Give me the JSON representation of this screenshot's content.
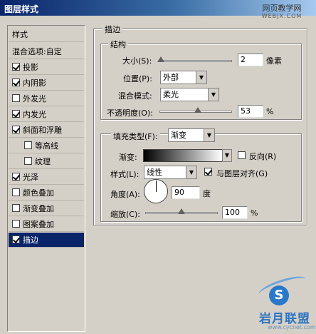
{
  "window": {
    "title": "图层样式"
  },
  "watermark_top": {
    "line1": "网页教学网",
    "line2": "WEBJX.COM"
  },
  "sidebar": {
    "header": "样式",
    "blend_options": "混合选项:自定",
    "items": [
      {
        "label": "投影",
        "checked": true
      },
      {
        "label": "内阴影",
        "checked": true
      },
      {
        "label": "外发光",
        "checked": false
      },
      {
        "label": "内发光",
        "checked": true
      },
      {
        "label": "斜面和浮雕",
        "checked": true
      },
      {
        "label": "等高线",
        "checked": false
      },
      {
        "label": "纹理",
        "checked": false
      },
      {
        "label": "光泽",
        "checked": true
      },
      {
        "label": "颜色叠加",
        "checked": false
      },
      {
        "label": "渐变叠加",
        "checked": false
      },
      {
        "label": "图案叠加",
        "checked": false
      },
      {
        "label": "描边",
        "checked": true,
        "selected": true
      }
    ]
  },
  "stroke": {
    "title": "描边",
    "structure": {
      "title": "结构",
      "size_label": "大小(S):",
      "size_value": "2",
      "size_unit": "像素",
      "size_fraction": 0.02,
      "position_label": "位置(P):",
      "position_value": "外部",
      "blend_mode_label": "混合模式:",
      "blend_mode_value": "柔光",
      "opacity_label": "不透明度(O):",
      "opacity_value": "53",
      "opacity_unit": "%",
      "opacity_fraction": 0.53
    },
    "fill": {
      "fill_type_label": "填充类型(F):",
      "fill_type_value": "渐变",
      "gradient_label": "渐变:",
      "reverse_label": "反向(R)",
      "reverse_checked": false,
      "style_label": "样式(L):",
      "style_value": "线性",
      "align_label": "与图层对齐(G)",
      "align_checked": true,
      "angle_label": "角度(A):",
      "angle_value": "90",
      "angle_unit": "度",
      "scale_label": "缩放(C):",
      "scale_value": "100",
      "scale_unit": "%",
      "scale_fraction": 0.5
    }
  },
  "watermark_bottom": {
    "brand": "岩月联盟",
    "url": "www.cycnet.com"
  }
}
